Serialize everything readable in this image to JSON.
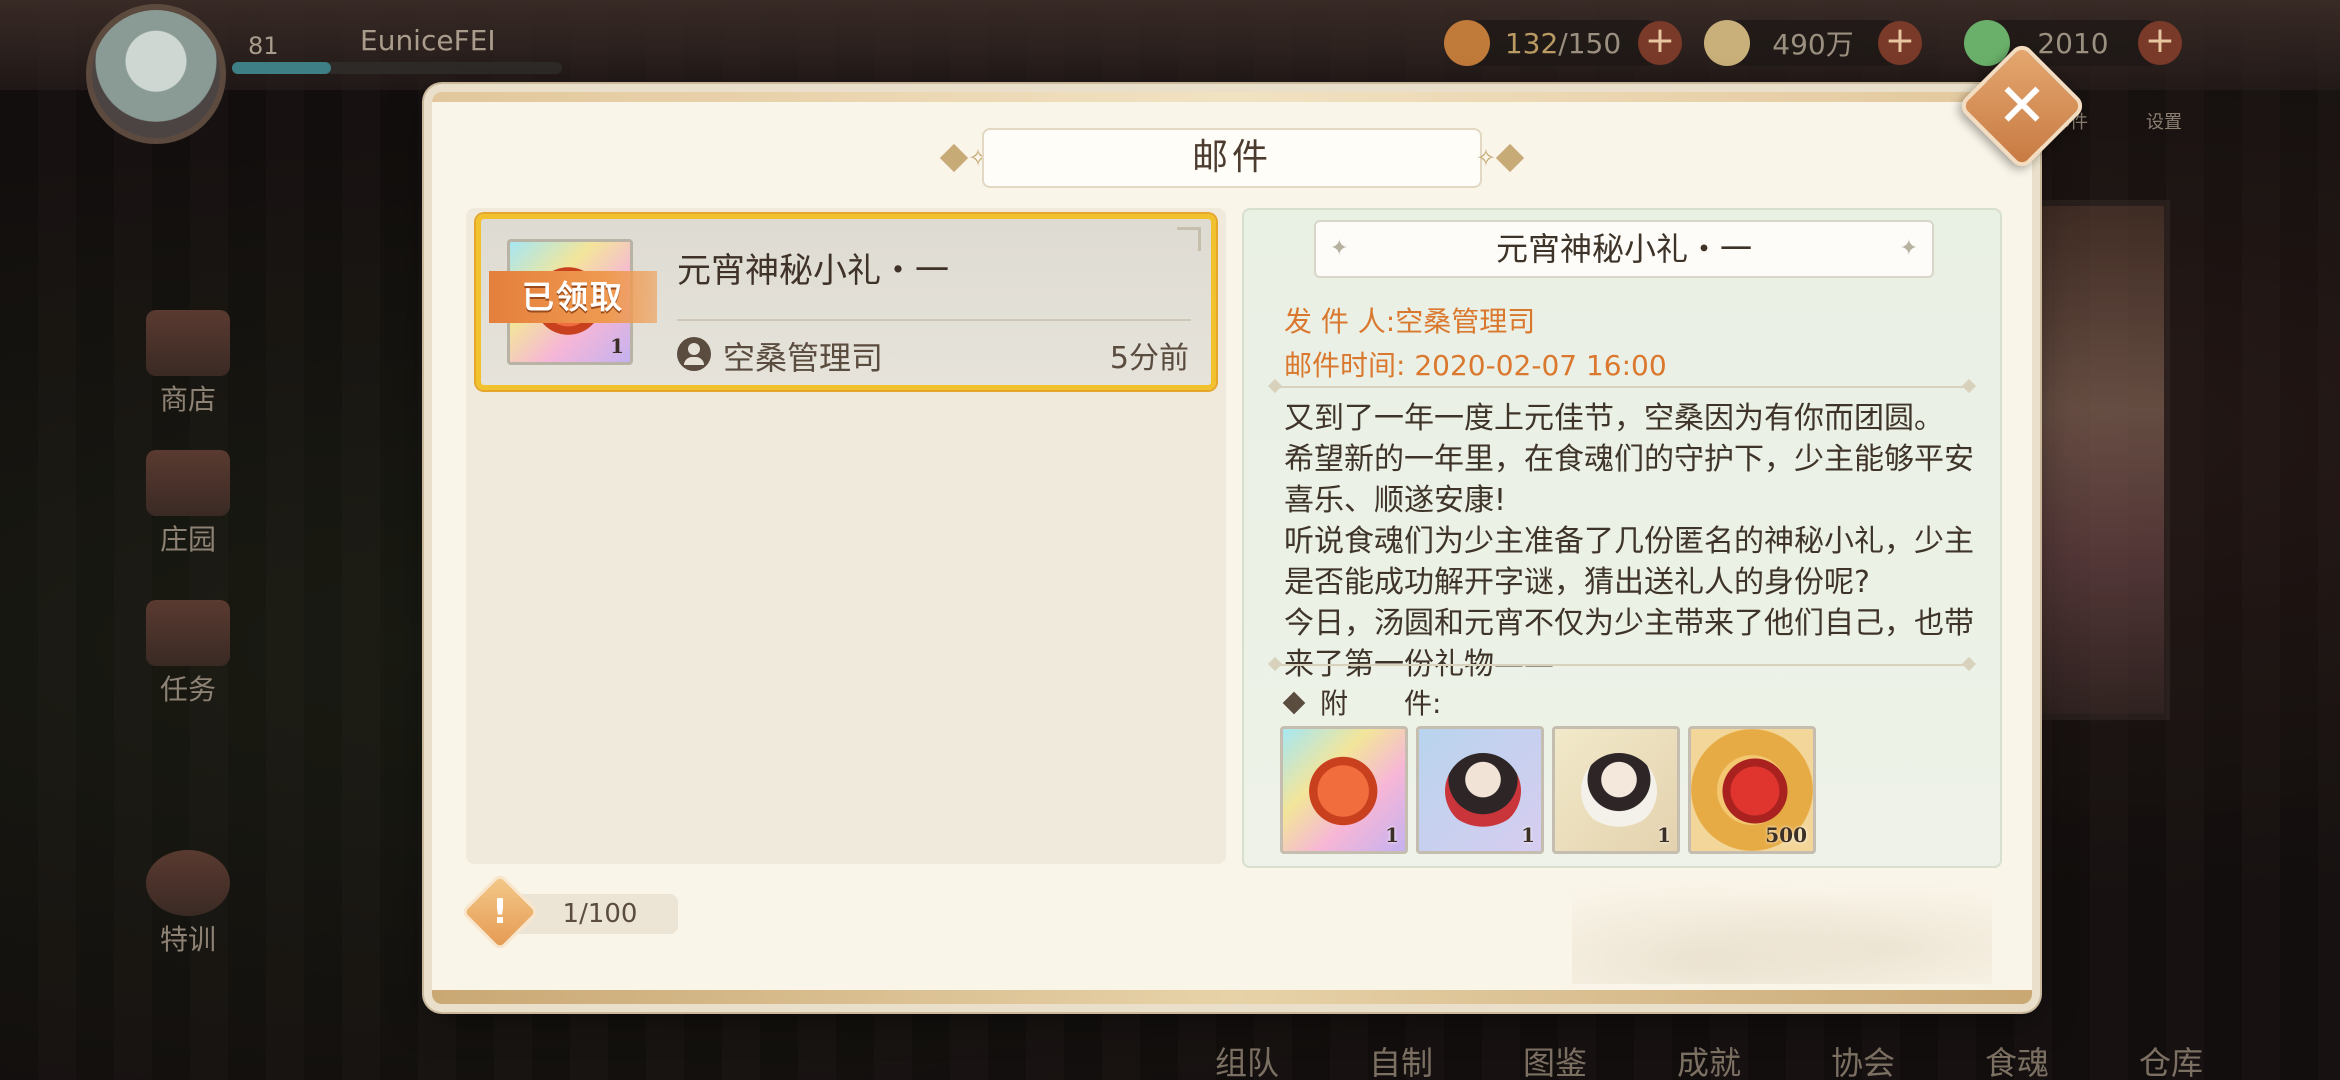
{
  "hud": {
    "level": "81",
    "player_name": "EuniceFEI",
    "exp_percent": 30,
    "resources": [
      {
        "name": "stamina",
        "value_current": "132",
        "value_max": "/150",
        "icon": "rice-bowl-icon",
        "color": "#c07a3a"
      },
      {
        "name": "coins",
        "value": "490万",
        "icon": "feather-coin-icon",
        "color": "#c9b07a"
      },
      {
        "name": "gems",
        "value": "2010",
        "icon": "jade-icon",
        "color": "#6ab06a"
      }
    ],
    "side_buttons": [
      "商店",
      "庄园",
      "任务",
      "特训"
    ],
    "top_icons": [
      "邮件",
      "设置"
    ],
    "bottom_nav": [
      "组队",
      "自制",
      "图鉴",
      "成就",
      "协会",
      "食魂",
      "仓库"
    ]
  },
  "modal": {
    "title": "邮件",
    "close_icon": "close-icon"
  },
  "mail_list": {
    "items": [
      {
        "title": "元宵神秘小礼・一",
        "sender": "空桑管理司",
        "time": "5分前",
        "status": "已领取",
        "attachment_count": "1",
        "selected": true
      }
    ]
  },
  "detail": {
    "title": "元宵神秘小礼・一",
    "sender_label": "发 件 人:",
    "sender": "空桑管理司",
    "time_label": "邮件时间:",
    "time": "2020-02-07 16:00",
    "body": [
      "又到了一年一度上元佳节，空桑因为有你而团圆。",
      "希望新的一年里，在食魂们的守护下，少主能够平安",
      "喜乐、顺遂安康!",
      "听说食魂们为少主准备了几份匿名的神秘小礼，少主",
      "是否能成功解开字谜，猜出送礼人的身份呢?",
      "今日，汤圆和元宵不仅为少主带来了他们自己，也带",
      "来了第一份礼物——"
    ],
    "attachments_label": "附　　件:",
    "attachments": [
      {
        "name": "mystery-gift-icon",
        "count": "1"
      },
      {
        "name": "soul-tangyuan-icon",
        "count": "1"
      },
      {
        "name": "soul-yuanxiao-icon",
        "count": "1"
      },
      {
        "name": "red-token-icon",
        "count": "500"
      }
    ]
  },
  "footer": {
    "mail_count": "1/100"
  },
  "colors": {
    "accent_orange": "#d9782e",
    "selected_border": "#f2c12e",
    "modal_bg": "#faf5e9"
  }
}
